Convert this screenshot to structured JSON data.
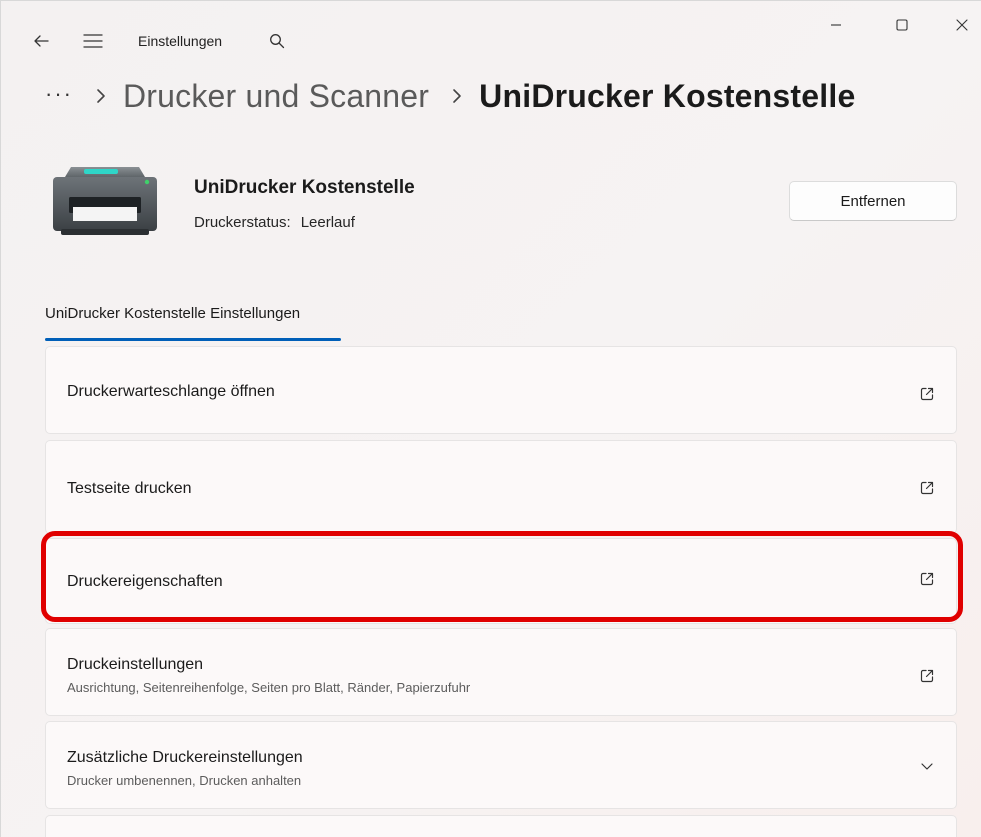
{
  "app": {
    "title": "Einstellungen"
  },
  "breadcrumb": {
    "ellipsis": "···",
    "parent": "Drucker und Scanner",
    "current": "UniDrucker Kostenstelle"
  },
  "printer": {
    "name": "UniDrucker Kostenstelle",
    "status_label": "Druckerstatus:",
    "status_value": "Leerlauf",
    "remove_label": "Entfernen"
  },
  "section": {
    "title": "UniDrucker Kostenstelle Einstellungen"
  },
  "cards": [
    {
      "title": "Druckerwarteschlange öffnen",
      "icon": "open-external-icon"
    },
    {
      "title": "Testseite drucken",
      "icon": "open-external-icon"
    },
    {
      "title": "Druckereigenschaften",
      "icon": "open-external-icon",
      "highlighted": true
    },
    {
      "title": "Druckeinstellungen",
      "subtitle": "Ausrichtung, Seitenreihenfolge, Seiten pro Blatt, Ränder, Papierzufuhr",
      "icon": "open-external-icon"
    },
    {
      "title": "Zusätzliche Druckereinstellungen",
      "subtitle": "Drucker umbenennen, Drucken anhalten",
      "icon": "chevron-down-icon"
    }
  ],
  "colors": {
    "accent": "#005fb8",
    "highlight": "#e00000",
    "printer_led": "#3fd16a",
    "printer_panel": "#2fd6c8"
  }
}
